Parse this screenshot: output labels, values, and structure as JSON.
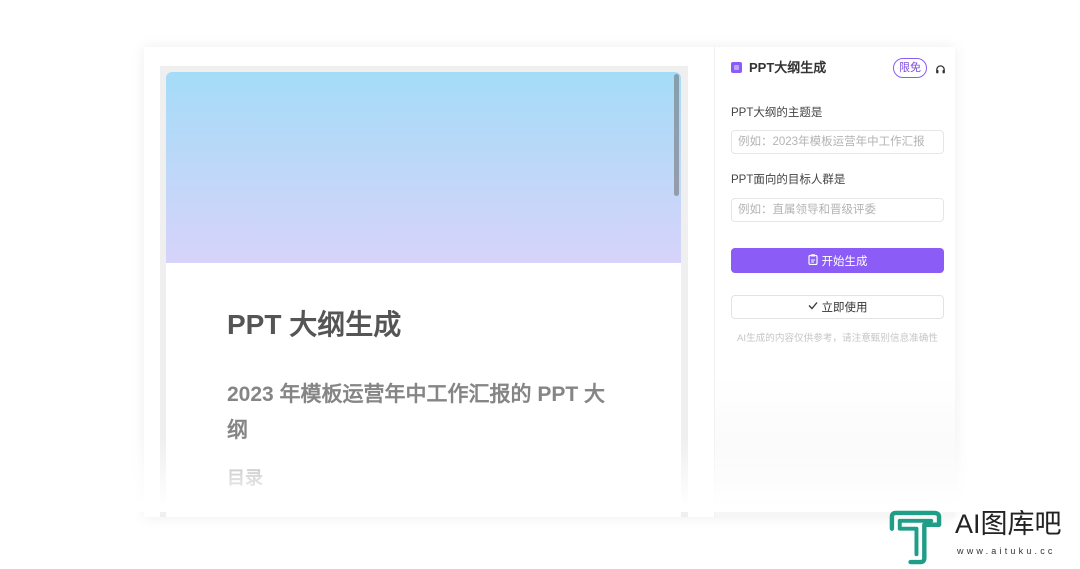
{
  "preview": {
    "title": "PPT 大纲生成",
    "subtitle_lines": [
      "2023 年模板运营年中工作汇报的 PPT 大",
      "纲"
    ],
    "section": "目录"
  },
  "panel": {
    "title": "PPT大纲生成",
    "badge": "限免",
    "fields": [
      {
        "label": "PPT大纲的主题是",
        "placeholder": "例如：2023年模板运营年中工作汇报",
        "value": ""
      },
      {
        "label": "PPT面向的目标人群是",
        "placeholder": "例如：直属领导和晋级评委",
        "value": ""
      }
    ],
    "generate_button": "开始生成",
    "use_button": "立即使用",
    "disclaimer": "AI生成的内容仅供参考，请注意甄别信息准确性"
  },
  "watermark": {
    "brand": "AI图库吧",
    "url": "www.aituku.cc"
  },
  "icons": {
    "panel_title": "ppt-icon",
    "support": "headset-icon",
    "generate": "clipboard-icon",
    "use": "check-icon",
    "watermark": "aituku-logo-icon"
  },
  "colors": {
    "accent": "#8b5cf6",
    "hero-top": "#a4dcf7",
    "hero-bottom": "#d7d3fa",
    "logo": "#1e9e86"
  }
}
